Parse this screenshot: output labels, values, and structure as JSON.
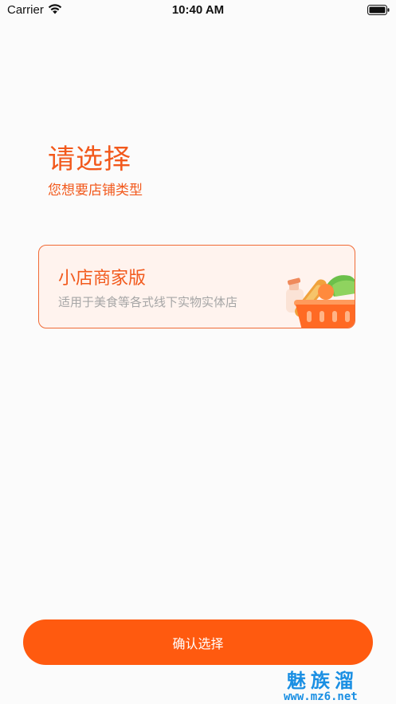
{
  "status_bar": {
    "carrier": "Carrier",
    "time": "10:40 AM",
    "wifi_icon": "wifi-icon",
    "battery_icon": "battery-icon"
  },
  "header": {
    "title": "请选择",
    "subtitle": "您想要店铺类型"
  },
  "store_option": {
    "title": "小店商家版",
    "description": "适用于美食等各式线下实物实体店",
    "icon": "shopping-basket-icon"
  },
  "confirm_button": {
    "label": "确认选择"
  },
  "watermark": {
    "logo_text": "魅族溜",
    "url": "www.mz6.net"
  },
  "colors": {
    "accent": "#f2591c",
    "button": "#ff5a0f",
    "card_border": "#f06a35",
    "card_background": "#fff3ee",
    "secondary_text": "#a6a6a6",
    "watermark": "#1a8fe3"
  }
}
